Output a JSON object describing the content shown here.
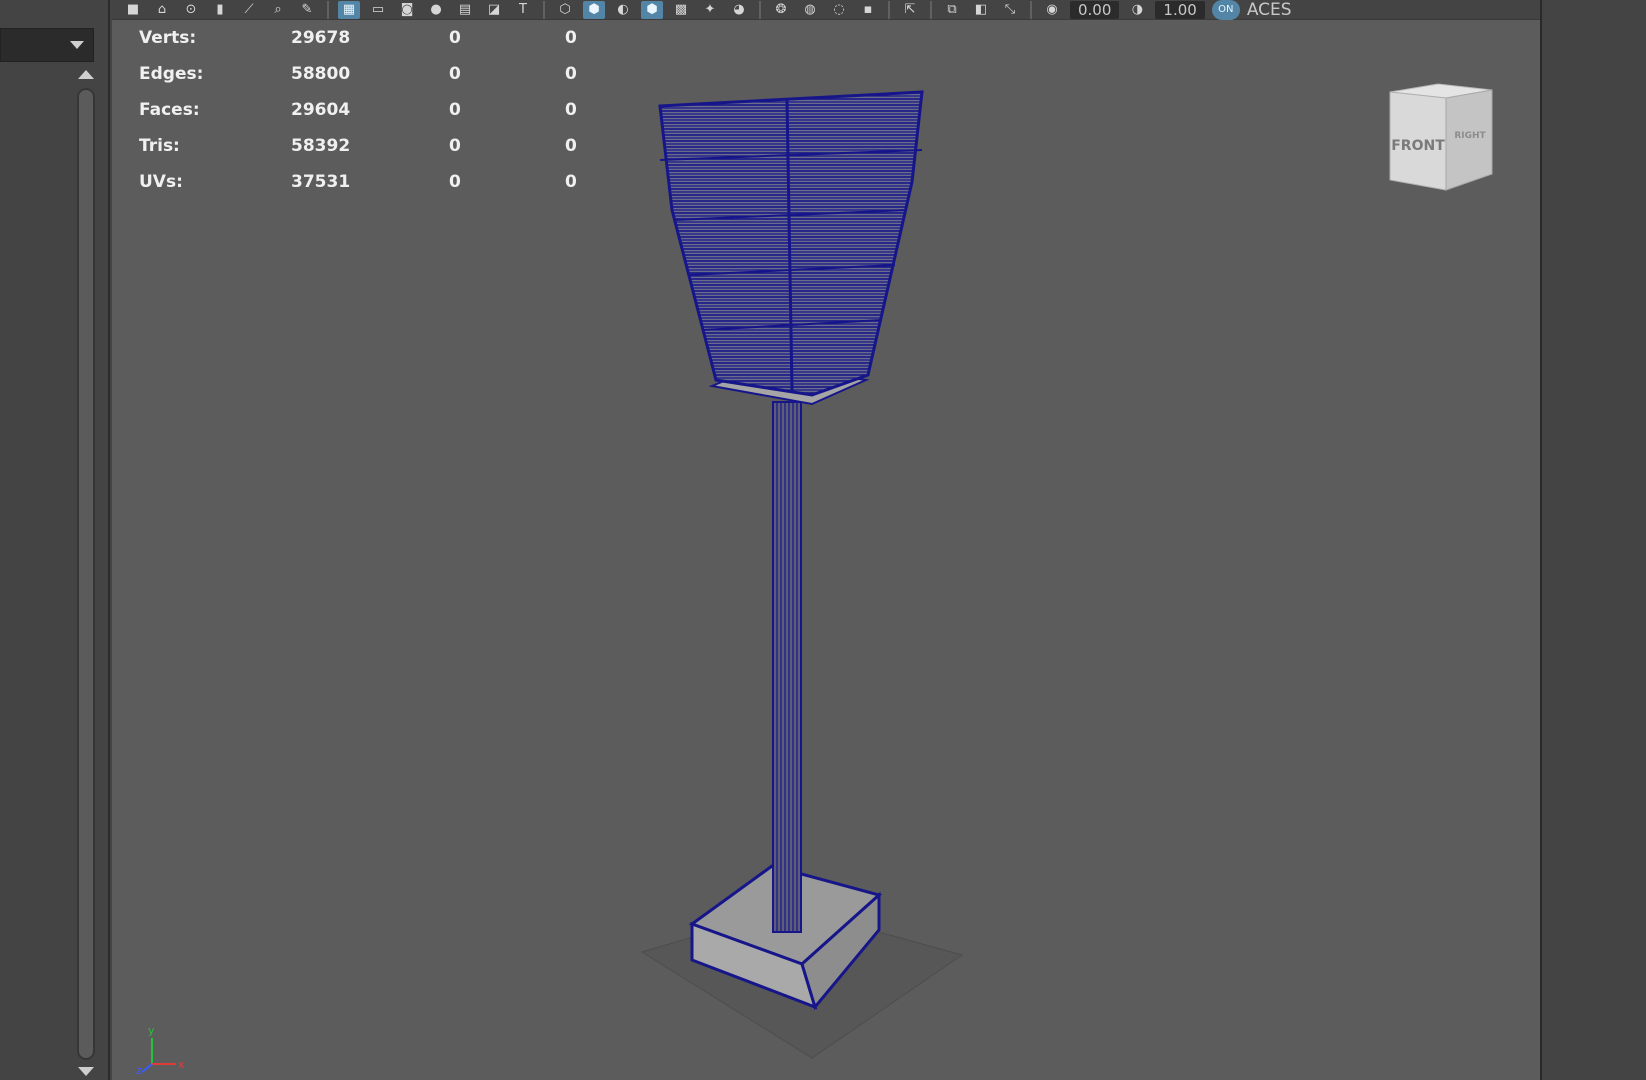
{
  "toolbar": {
    "exposure_value": "0.00",
    "gamma_value": "1.00",
    "toggle_label": "ON",
    "colorspace_label": "ACES"
  },
  "hud": {
    "rows": [
      {
        "label": "Verts:",
        "values": [
          "29678",
          "0",
          "0"
        ]
      },
      {
        "label": "Edges:",
        "values": [
          "58800",
          "0",
          "0"
        ]
      },
      {
        "label": "Faces:",
        "values": [
          "29604",
          "0",
          "0"
        ]
      },
      {
        "label": "Tris:",
        "values": [
          "58392",
          "0",
          "0"
        ]
      },
      {
        "label": "UVs:",
        "values": [
          "37531",
          "0",
          "0"
        ]
      }
    ]
  },
  "view_cube": {
    "front_label": "FRONT",
    "right_label": "RIGHT"
  },
  "axis_gizmo": {
    "x_label": "x",
    "y_label": "y",
    "z_label": "z"
  },
  "colors": {
    "viewport_bg": "#5c5c5c",
    "wireframe": "#16168a",
    "active_button": "#5285a6"
  }
}
